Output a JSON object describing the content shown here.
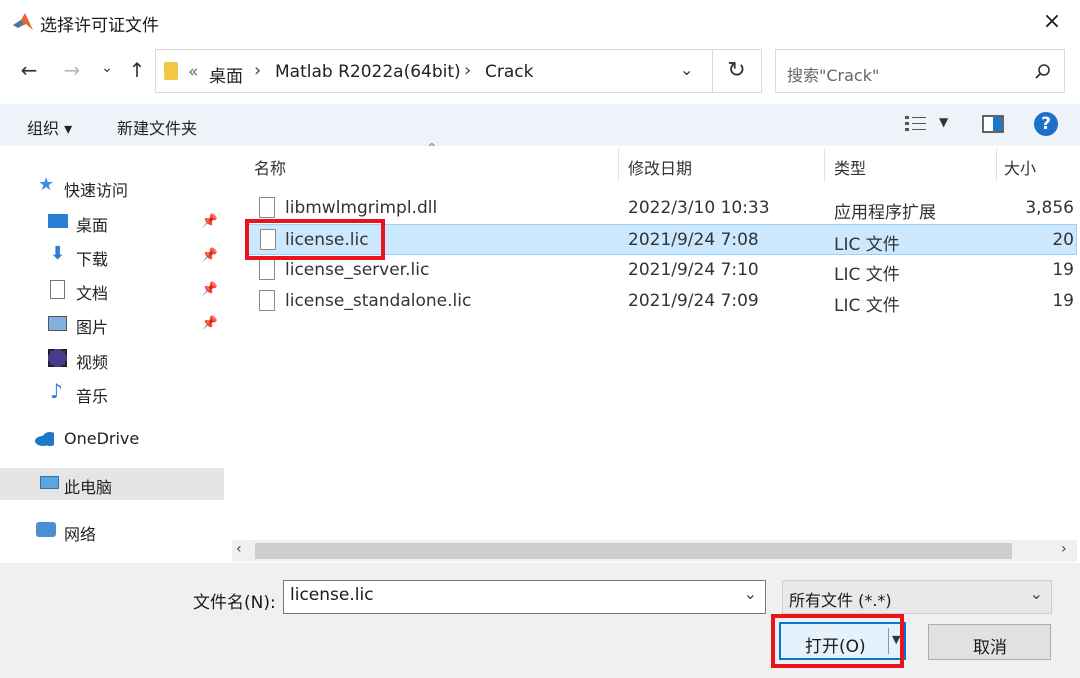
{
  "window": {
    "title": "选择许可证文件",
    "close": "×"
  },
  "address": {
    "chevron": "«",
    "breadcrumbs": [
      "桌面",
      "Matlab R2022a(64bit)",
      "Crack"
    ],
    "search_placeholder": "搜索\"Crack\""
  },
  "toolbar": {
    "organize": "组织 ▾",
    "new_folder": "新建文件夹"
  },
  "sidebar": {
    "quick_access": "快速访问",
    "items": [
      "桌面",
      "下载",
      "文档",
      "图片",
      "视频",
      "音乐"
    ],
    "onedrive": "OneDrive",
    "this_pc": "此电脑",
    "network": "网络"
  },
  "columns": {
    "name": "名称",
    "modified": "修改日期",
    "type": "类型",
    "size": "大小"
  },
  "files": [
    {
      "name": "libmwlmgrimpl.dll",
      "modified": "2022/3/10 10:33",
      "type": "应用程序扩展",
      "size": "3,856"
    },
    {
      "name": "license.lic",
      "modified": "2021/9/24 7:08",
      "type": "LIC 文件",
      "size": "20"
    },
    {
      "name": "license_server.lic",
      "modified": "2021/9/24 7:10",
      "type": "LIC 文件",
      "size": "19"
    },
    {
      "name": "license_standalone.lic",
      "modified": "2021/9/24 7:09",
      "type": "LIC 文件",
      "size": "19"
    }
  ],
  "bottom": {
    "filename_label": "文件名(N):",
    "filename_value": "license.lic",
    "filetype": "所有文件 (*.*)",
    "open": "打开(O)",
    "cancel": "取消"
  },
  "colors": {
    "selection": "#cce8ff",
    "highlight": "#e8131b",
    "accent": "#0078d7"
  }
}
